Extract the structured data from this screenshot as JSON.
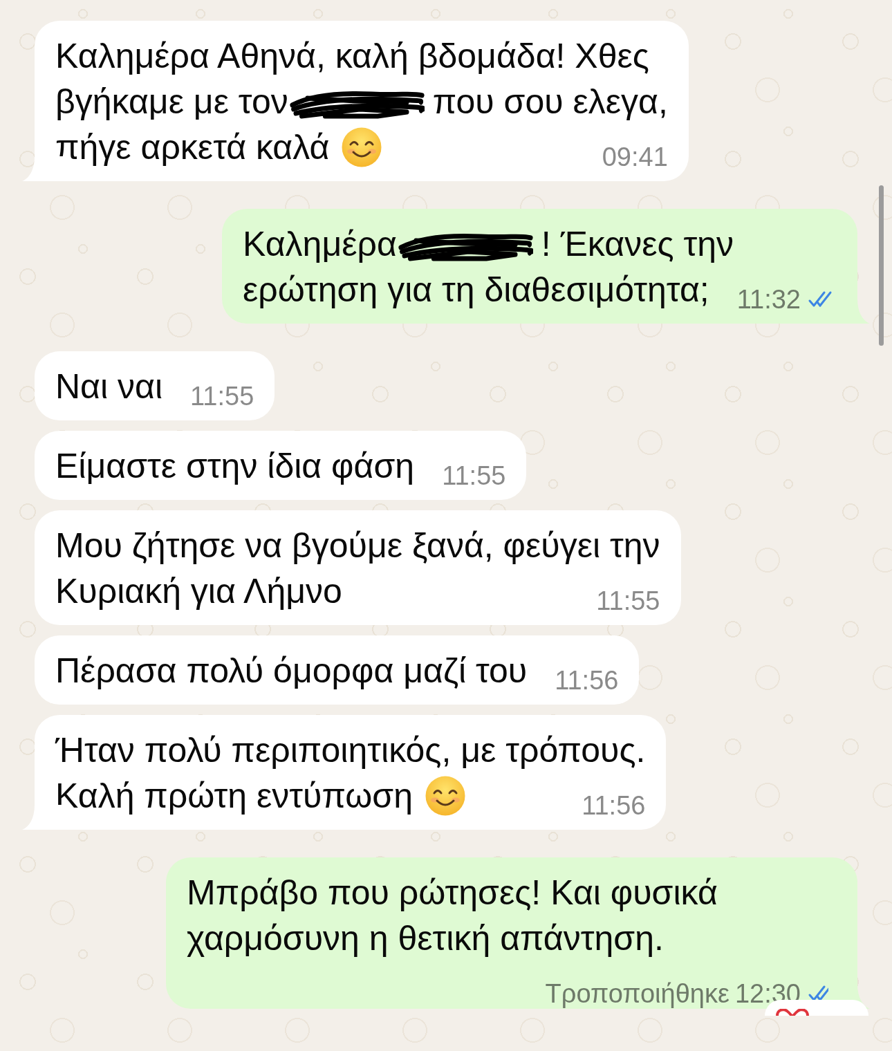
{
  "messages": [
    {
      "outgoing": false,
      "tail": true,
      "lines": [
        [
          {
            "kind": "text",
            "text": "Καλημέρα Αθηνά, καλή βδομάδα! Χθες"
          }
        ],
        [
          {
            "kind": "text",
            "text": "βγήκαμε με τον"
          },
          {
            "kind": "redaction"
          },
          {
            "kind": "text",
            "text": "που σου ελεγα,"
          }
        ],
        [
          {
            "kind": "text",
            "text": "πήγε αρκετά καλά"
          },
          {
            "kind": "emoji"
          }
        ]
      ],
      "time": "09:41"
    },
    {
      "outgoing": true,
      "tail": true,
      "lines": [
        [
          {
            "kind": "text",
            "text": "Καλημέρα"
          },
          {
            "kind": "redaction"
          },
          {
            "kind": "text",
            "text": "! Έκανες την"
          }
        ],
        [
          {
            "kind": "text",
            "text": "ερώτηση για τη διαθεσιμότητα;"
          }
        ]
      ],
      "time": "11:32",
      "read": true
    },
    {
      "outgoing": false,
      "tail": false,
      "lines": [
        [
          {
            "kind": "text",
            "text": "Ναι ναι"
          }
        ]
      ],
      "time": "11:55"
    },
    {
      "outgoing": false,
      "tail": false,
      "lines": [
        [
          {
            "kind": "text",
            "text": "Είμαστε στην ίδια φάση"
          }
        ]
      ],
      "time": "11:55"
    },
    {
      "outgoing": false,
      "tail": false,
      "lines": [
        [
          {
            "kind": "text",
            "text": "Μου ζήτησε να βγούμε ξανά, φεύγει την"
          }
        ],
        [
          {
            "kind": "text",
            "text": "Κυριακή για Λήμνο"
          }
        ]
      ],
      "time": "11:55"
    },
    {
      "outgoing": false,
      "tail": false,
      "lines": [
        [
          {
            "kind": "text",
            "text": "Πέρασα πολύ όμορφα μαζί του"
          }
        ]
      ],
      "time": "11:56"
    },
    {
      "outgoing": false,
      "tail": true,
      "lines": [
        [
          {
            "kind": "text",
            "text": "Ήταν πολύ περιποιητικός, με τρόπους."
          }
        ],
        [
          {
            "kind": "text",
            "text": "Καλή πρώτη εντύπωση"
          },
          {
            "kind": "emoji"
          }
        ]
      ],
      "time": "11:56"
    },
    {
      "outgoing": true,
      "tail": true,
      "lines": [
        [
          {
            "kind": "text",
            "text": "Μπράβο που ρώτησες! Και φυσικά"
          }
        ],
        [
          {
            "kind": "text",
            "text": "χαρμόσυνη η θετική απάντηση."
          }
        ]
      ],
      "edited_label": "Τροποποιήθηκε",
      "time": "12:30",
      "read": true,
      "reacted": true
    }
  ]
}
